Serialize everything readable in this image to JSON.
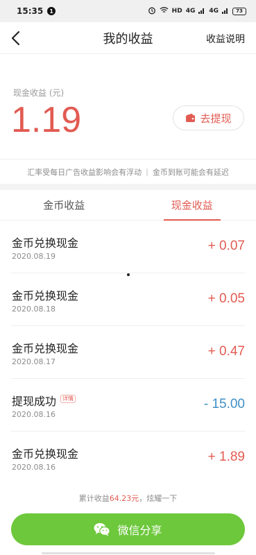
{
  "status_bar": {
    "time": "15:35",
    "notification_count": "1",
    "network_label": "HD",
    "signal_1": "4G",
    "signal_2": "4G",
    "battery": "73"
  },
  "header": {
    "title": "我的收益",
    "right_link": "收益说明",
    "back_icon": "chevron-left-icon"
  },
  "summary": {
    "label": "现金收益 (元)",
    "amount": "1.19",
    "withdraw_label": "去提现",
    "withdraw_icon": "wallet-icon"
  },
  "notice": {
    "left": "汇率受每日广告收益影响会有浮动",
    "separator": "|",
    "right": "金币到账可能会有延迟"
  },
  "tabs": [
    {
      "label": "金币收益",
      "active": false
    },
    {
      "label": "现金收益",
      "active": true
    }
  ],
  "records": [
    {
      "title": "金币兑换现金",
      "date": "2020.08.19",
      "amount": "+ 0.07",
      "tag": ""
    },
    {
      "title": "金币兑换现金",
      "date": "2020.08.18",
      "amount": "+ 0.05",
      "tag": ""
    },
    {
      "title": "金币兑换现金",
      "date": "2020.08.17",
      "amount": "+ 0.47",
      "tag": ""
    },
    {
      "title": "提现成功",
      "date": "2020.08.16",
      "amount": "- 15.00",
      "tag": "详情"
    },
    {
      "title": "金币兑换现金",
      "date": "2020.08.16",
      "amount": "+ 1.89",
      "tag": ""
    }
  ],
  "footer": {
    "total_prefix": "累计收益",
    "total_amount": "64.23元",
    "total_suffix": "，炫耀一下",
    "share_label": "微信分享",
    "share_icon": "wechat-icon"
  },
  "colors": {
    "accent_red": "#e25b52",
    "negative_blue": "#3f8fc6",
    "share_green": "#6dc83c"
  }
}
